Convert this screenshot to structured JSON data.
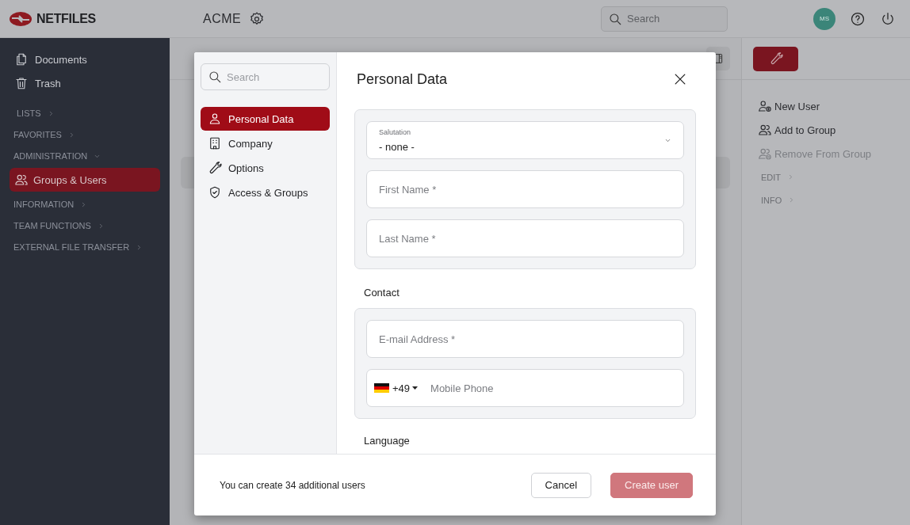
{
  "header": {
    "logo_text": "NETFILES",
    "organization": "ACME",
    "search": {
      "placeholder": "Search"
    },
    "avatar": "MS"
  },
  "sidebar": {
    "items": [
      {
        "kind": "link",
        "label": "Documents"
      },
      {
        "kind": "link",
        "label": "Trash"
      },
      {
        "kind": "section",
        "label": "LISTS",
        "expanded": false
      },
      {
        "kind": "section",
        "label": "FAVORITES",
        "expanded": false
      },
      {
        "kind": "section",
        "label": "ADMINISTRATION",
        "expanded": true,
        "children": [
          {
            "label": "Groups & Users",
            "selected": true
          }
        ]
      },
      {
        "kind": "section",
        "label": "INFORMATION",
        "expanded": false
      },
      {
        "kind": "section",
        "label": "TEAM FUNCTIONS",
        "expanded": false
      },
      {
        "kind": "section",
        "label": "EXTERNAL FILE TRANSFER",
        "expanded": false
      }
    ]
  },
  "right_panel": {
    "actions": [
      {
        "label": "New User",
        "disabled": false
      },
      {
        "label": "Add to Group",
        "disabled": false
      },
      {
        "label": "Remove From Group",
        "disabled": true
      }
    ],
    "sections": [
      {
        "label": "EDIT",
        "expanded": false
      },
      {
        "label": "INFO",
        "expanded": false
      }
    ]
  },
  "modal": {
    "nav_search": {
      "placeholder": "Search"
    },
    "nav_items": [
      {
        "label": "Personal Data",
        "selected": true
      },
      {
        "label": "Company",
        "selected": false
      },
      {
        "label": "Options",
        "selected": false
      },
      {
        "label": "Access & Groups",
        "selected": false
      }
    ],
    "title": "Personal Data",
    "groups": [
      {
        "fields": [
          {
            "kind": "select",
            "label": "Salutation",
            "value": "- none -"
          },
          {
            "kind": "text",
            "placeholder": "First Name *"
          },
          {
            "kind": "text",
            "placeholder": "Last Name *"
          }
        ]
      },
      {
        "heading": "Contact",
        "fields": [
          {
            "kind": "text",
            "placeholder": "E-mail Address *"
          },
          {
            "kind": "phone",
            "country_code": "+49",
            "placeholder": "Mobile Phone"
          }
        ]
      },
      {
        "heading": "Language"
      }
    ],
    "footer_note": "You can create 34 additional users",
    "buttons": [
      {
        "label": "Cancel",
        "kind": "secondary"
      },
      {
        "label": "Create user",
        "kind": "primary",
        "disabled": true
      }
    ]
  }
}
